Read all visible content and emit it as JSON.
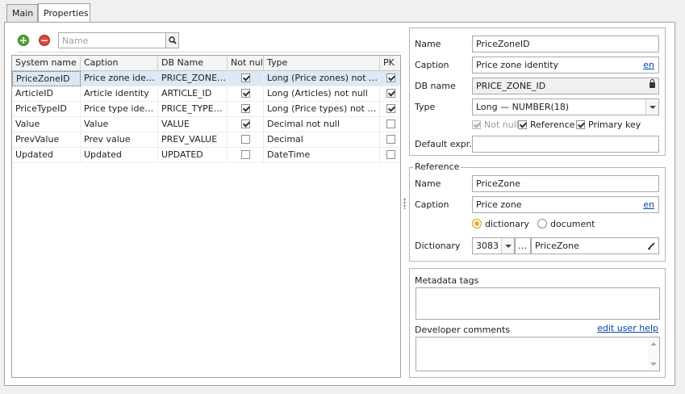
{
  "tabs": [
    {
      "label": "Main",
      "active": false
    },
    {
      "label": "Properties",
      "active": true
    }
  ],
  "toolbar": {
    "add_icon": "plus-circle-icon",
    "remove_icon": "minus-circle-icon",
    "search_placeholder": "Name",
    "search_icon": "magnifier-icon"
  },
  "grid": {
    "columns": [
      "System name",
      "Caption",
      "DB Name",
      "Not null",
      "Type",
      "PK"
    ],
    "rows": [
      {
        "system_name": "PriceZoneID",
        "caption": "Price zone identity",
        "db_name": "PRICE_ZONE…",
        "not_null": true,
        "type": "Long (Price zones) not null",
        "pk": true,
        "selected": true
      },
      {
        "system_name": "ArticleID",
        "caption": "Article identity",
        "db_name": "ARTICLE_ID",
        "not_null": true,
        "type": "Long (Articles) not null",
        "pk": true,
        "selected": false
      },
      {
        "system_name": "PriceTypeID",
        "caption": "Price type identity",
        "db_name": "PRICE_TYPE_ID",
        "not_null": true,
        "type": "Long (Price types) not null",
        "pk": true,
        "selected": false
      },
      {
        "system_name": "Value",
        "caption": "Value",
        "db_name": "VALUE",
        "not_null": true,
        "type": "Decimal not null",
        "pk": false,
        "selected": false
      },
      {
        "system_name": "PrevValue",
        "caption": "Prev value",
        "db_name": "PREV_VALUE",
        "not_null": false,
        "type": "Decimal",
        "pk": false,
        "selected": false
      },
      {
        "system_name": "Updated",
        "caption": "Updated",
        "db_name": "UPDATED",
        "not_null": false,
        "type": "DateTime",
        "pk": false,
        "selected": false
      }
    ]
  },
  "props": {
    "name_label": "Name",
    "name_value": "PriceZoneID",
    "caption_label": "Caption",
    "caption_value": "Price zone identity",
    "caption_lang": "en",
    "dbname_label": "DB name",
    "dbname_value": "PRICE_ZONE_ID",
    "type_label": "Type",
    "type_value": "Long — NUMBER(18)",
    "not_null_label": "Not null",
    "reference_label": "Reference",
    "primary_key_label": "Primary key",
    "default_label": "Default expr.",
    "default_value": ""
  },
  "reference": {
    "title": "Reference",
    "name_label": "Name",
    "name_value": "PriceZone",
    "caption_label": "Caption",
    "caption_value": "Price zone",
    "caption_lang": "en",
    "radio_dictionary": "dictionary",
    "radio_document": "document",
    "dictionary_label": "Dictionary",
    "dictionary_id": "3083",
    "dictionary_name": "PriceZone",
    "dots": "…"
  },
  "meta": {
    "tags_label": "Metadata tags",
    "tags_value": "",
    "comments_label": "Developer comments",
    "edit_help_link": "edit user help",
    "comments_value": ""
  },
  "colors": {
    "selection": "#dbe8f6",
    "link": "#0645ad",
    "add_green": "#4aa832",
    "remove_red": "#d64b3e"
  }
}
